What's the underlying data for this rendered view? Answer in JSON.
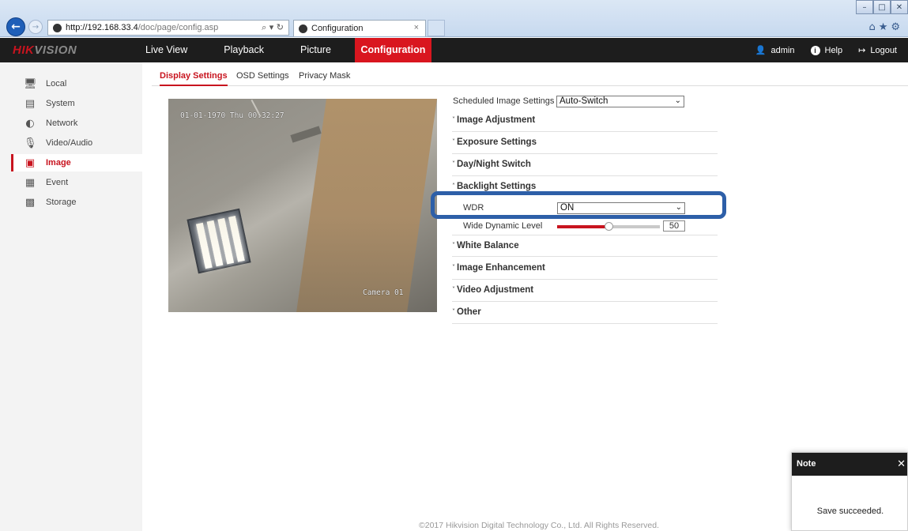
{
  "browser": {
    "url_host": "http://192.168.33.4",
    "url_path": "/doc/page/config.asp",
    "address_tools": "⌕ ▾ ↻",
    "tab_title": "Configuration",
    "tab_close": "×",
    "win_minimize": "–",
    "win_maximize": "□",
    "win_close": "✕",
    "icons": "⌂★⚙"
  },
  "header": {
    "logo_red": "HIK",
    "logo_rest": "VISION",
    "nav": [
      "Live View",
      "Playback",
      "Picture",
      "Configuration"
    ],
    "user": "admin",
    "help": "Help",
    "logout": "Logout",
    "colors": {
      "bar": "#1d1d1d",
      "accent": "#d9161f"
    }
  },
  "sidebar": {
    "items": [
      {
        "label": "Local",
        "icon": "monitor-icon",
        "glyph": "🖥"
      },
      {
        "label": "System",
        "icon": "window-icon",
        "glyph": "▤"
      },
      {
        "label": "Network",
        "icon": "globe-icon",
        "glyph": "◐"
      },
      {
        "label": "Video/Audio",
        "icon": "microphone-icon",
        "glyph": "🎙"
      },
      {
        "label": "Image",
        "icon": "image-icon",
        "glyph": "▣"
      },
      {
        "label": "Event",
        "icon": "calendar-icon",
        "glyph": "▦"
      },
      {
        "label": "Storage",
        "icon": "disk-icon",
        "glyph": "▩"
      }
    ],
    "active": "Image"
  },
  "subtabs": [
    "Display Settings",
    "OSD Settings",
    "Privacy Mask"
  ],
  "video": {
    "osd_time": "01-01-1970 Thu 00:32:27",
    "osd_name": "Camera 01"
  },
  "settings": {
    "scheduled_label": "Scheduled Image Settings",
    "scheduled_value": "Auto-Switch",
    "sections": {
      "image_adjustment": "Image Adjustment",
      "exposure": "Exposure Settings",
      "day_night": "Day/Night Switch",
      "backlight": "Backlight Settings",
      "white_balance": "White Balance",
      "image_enhancement": "Image Enhancement",
      "video_adjustment": "Video Adjustment",
      "other": "Other"
    },
    "caret_closed": "˅",
    "caret_open": "˄",
    "wdr_label": "WDR",
    "wdr_value": "ON",
    "wdl_label": "Wide Dynamic Level",
    "wdl_value": "50",
    "wdl_fraction": 0.5
  },
  "note": {
    "title": "Note",
    "close": "✕",
    "message": "Save succeeded."
  },
  "footer": "©2017 Hikvision Digital Technology Co., Ltd. All Rights Reserved."
}
